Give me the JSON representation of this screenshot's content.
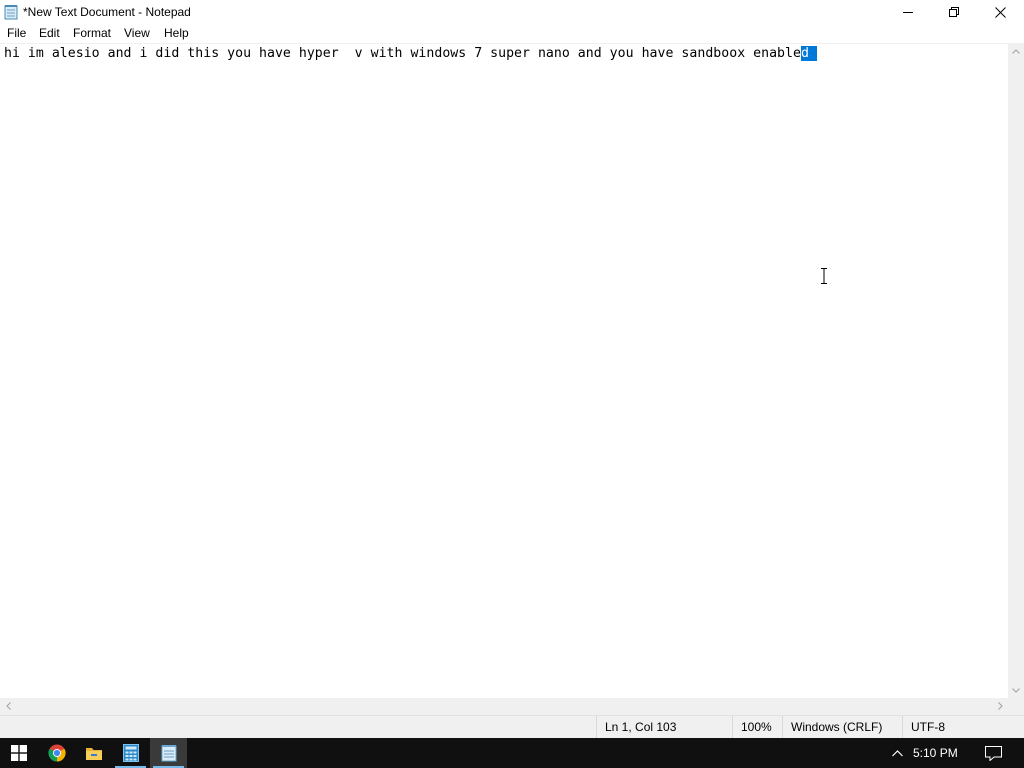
{
  "window": {
    "title": "*New Text Document - Notepad",
    "icon": "notepad-icon",
    "controls": [
      "minimize-icon",
      "restore-icon",
      "close-icon"
    ]
  },
  "menu": {
    "file": "File",
    "edit": "Edit",
    "format": "Format",
    "view": "View",
    "help": "Help"
  },
  "editor": {
    "text_before_selection": "hi im alesio and i did this you have hyper  v with windows 7 super nano and you have sandboox enable",
    "selected_text": "d",
    "selection_color": "#0078d7"
  },
  "status": {
    "position": "Ln 1, Col 103",
    "zoom": "100%",
    "line_ending": "Windows (CRLF)",
    "encoding": "UTF-8"
  },
  "taskbar": {
    "pinned": [
      "windows-start-icon",
      "chrome-icon",
      "file-explorer-icon",
      "calculator-icon",
      "notepad-icon"
    ],
    "active": "notepad-icon",
    "clock": "5:10 PM"
  }
}
